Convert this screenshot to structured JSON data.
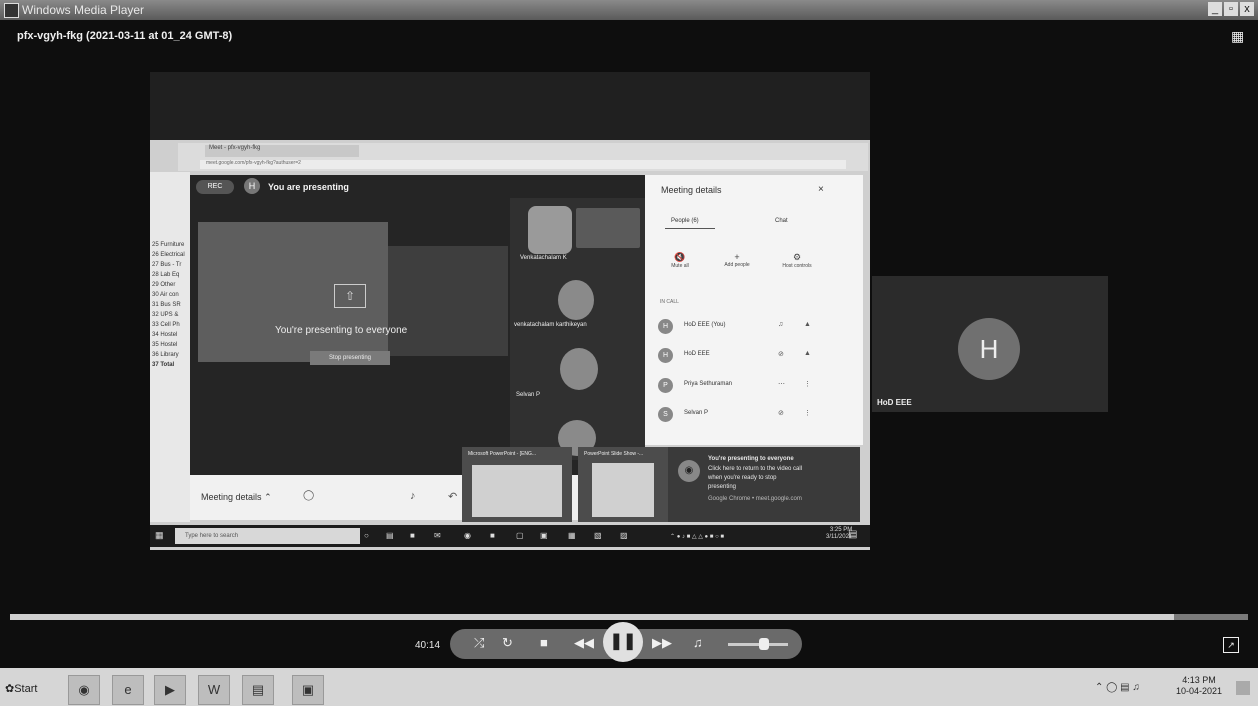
{
  "window": {
    "title": "Windows Media Player",
    "minimize": "_",
    "maximize": "▫",
    "close": "x"
  },
  "media": {
    "title": "pfx-vgyh-fkg (2021-03-11 at 01_24 GMT-8)"
  },
  "browser": {
    "tab_label": "Meet - pfx-vgyh-fkg",
    "address": "meet.google.com/pfx-vgyh-fkg?authuser=2"
  },
  "excel_rows": [
    "25 Furniture",
    "26 Electrical",
    "27 Bus - Tr",
    "28 Lab Eq",
    "29 Other",
    "30 Air con",
    "31 Bus SR",
    "32 UPS &",
    "33 Cell Ph",
    "34 Hostel",
    "35 Hostel",
    "36 Library",
    "37 Total"
  ],
  "meet": {
    "rec": "REC",
    "presenter_initial": "H",
    "you_are_presenting": "You are presenting",
    "presenting_to_everyone": "You're presenting to everyone",
    "stop_presenting": "Stop presenting",
    "meeting_details": "Meeting details",
    "participants": [
      "Venkatachalam K",
      "venkatachalam karthikeyan",
      "Selvan P"
    ]
  },
  "panel": {
    "title": "Meeting details",
    "close": "×",
    "tab_people": "People (6)",
    "tab_chat": "Chat",
    "actions": [
      "Mute all",
      "Add people",
      "Host controls"
    ],
    "in_call": "IN CALL",
    "people": [
      {
        "initial": "H",
        "name": "HoD EEE (You)"
      },
      {
        "initial": "H",
        "name": "HoD EEE"
      },
      {
        "initial": "P",
        "name": "Priya Sethuraman"
      },
      {
        "initial": "S",
        "name": "Selvan P"
      }
    ]
  },
  "popups": {
    "pp1": "Microsoft PowerPoint - [ENG...",
    "pp2": "PowerPoint Slide Show -...",
    "notif_title": "You're presenting to everyone",
    "notif_lines": [
      "Click here to return to the video call",
      "when you're ready to stop",
      "presenting"
    ],
    "notif_source": "Google Chrome • meet.google.com"
  },
  "inner_taskbar": {
    "search": "Type here to search",
    "time": "3:25 PM",
    "date": "3/11/2021"
  },
  "hod_tile": {
    "initial": "H",
    "name": "HoD EEE"
  },
  "player": {
    "elapsed": "40:14",
    "seek_progress": 0.94,
    "volume": 0.6
  },
  "os": {
    "start": "Start",
    "time": "4:13 PM",
    "date": "10-04-2021"
  }
}
